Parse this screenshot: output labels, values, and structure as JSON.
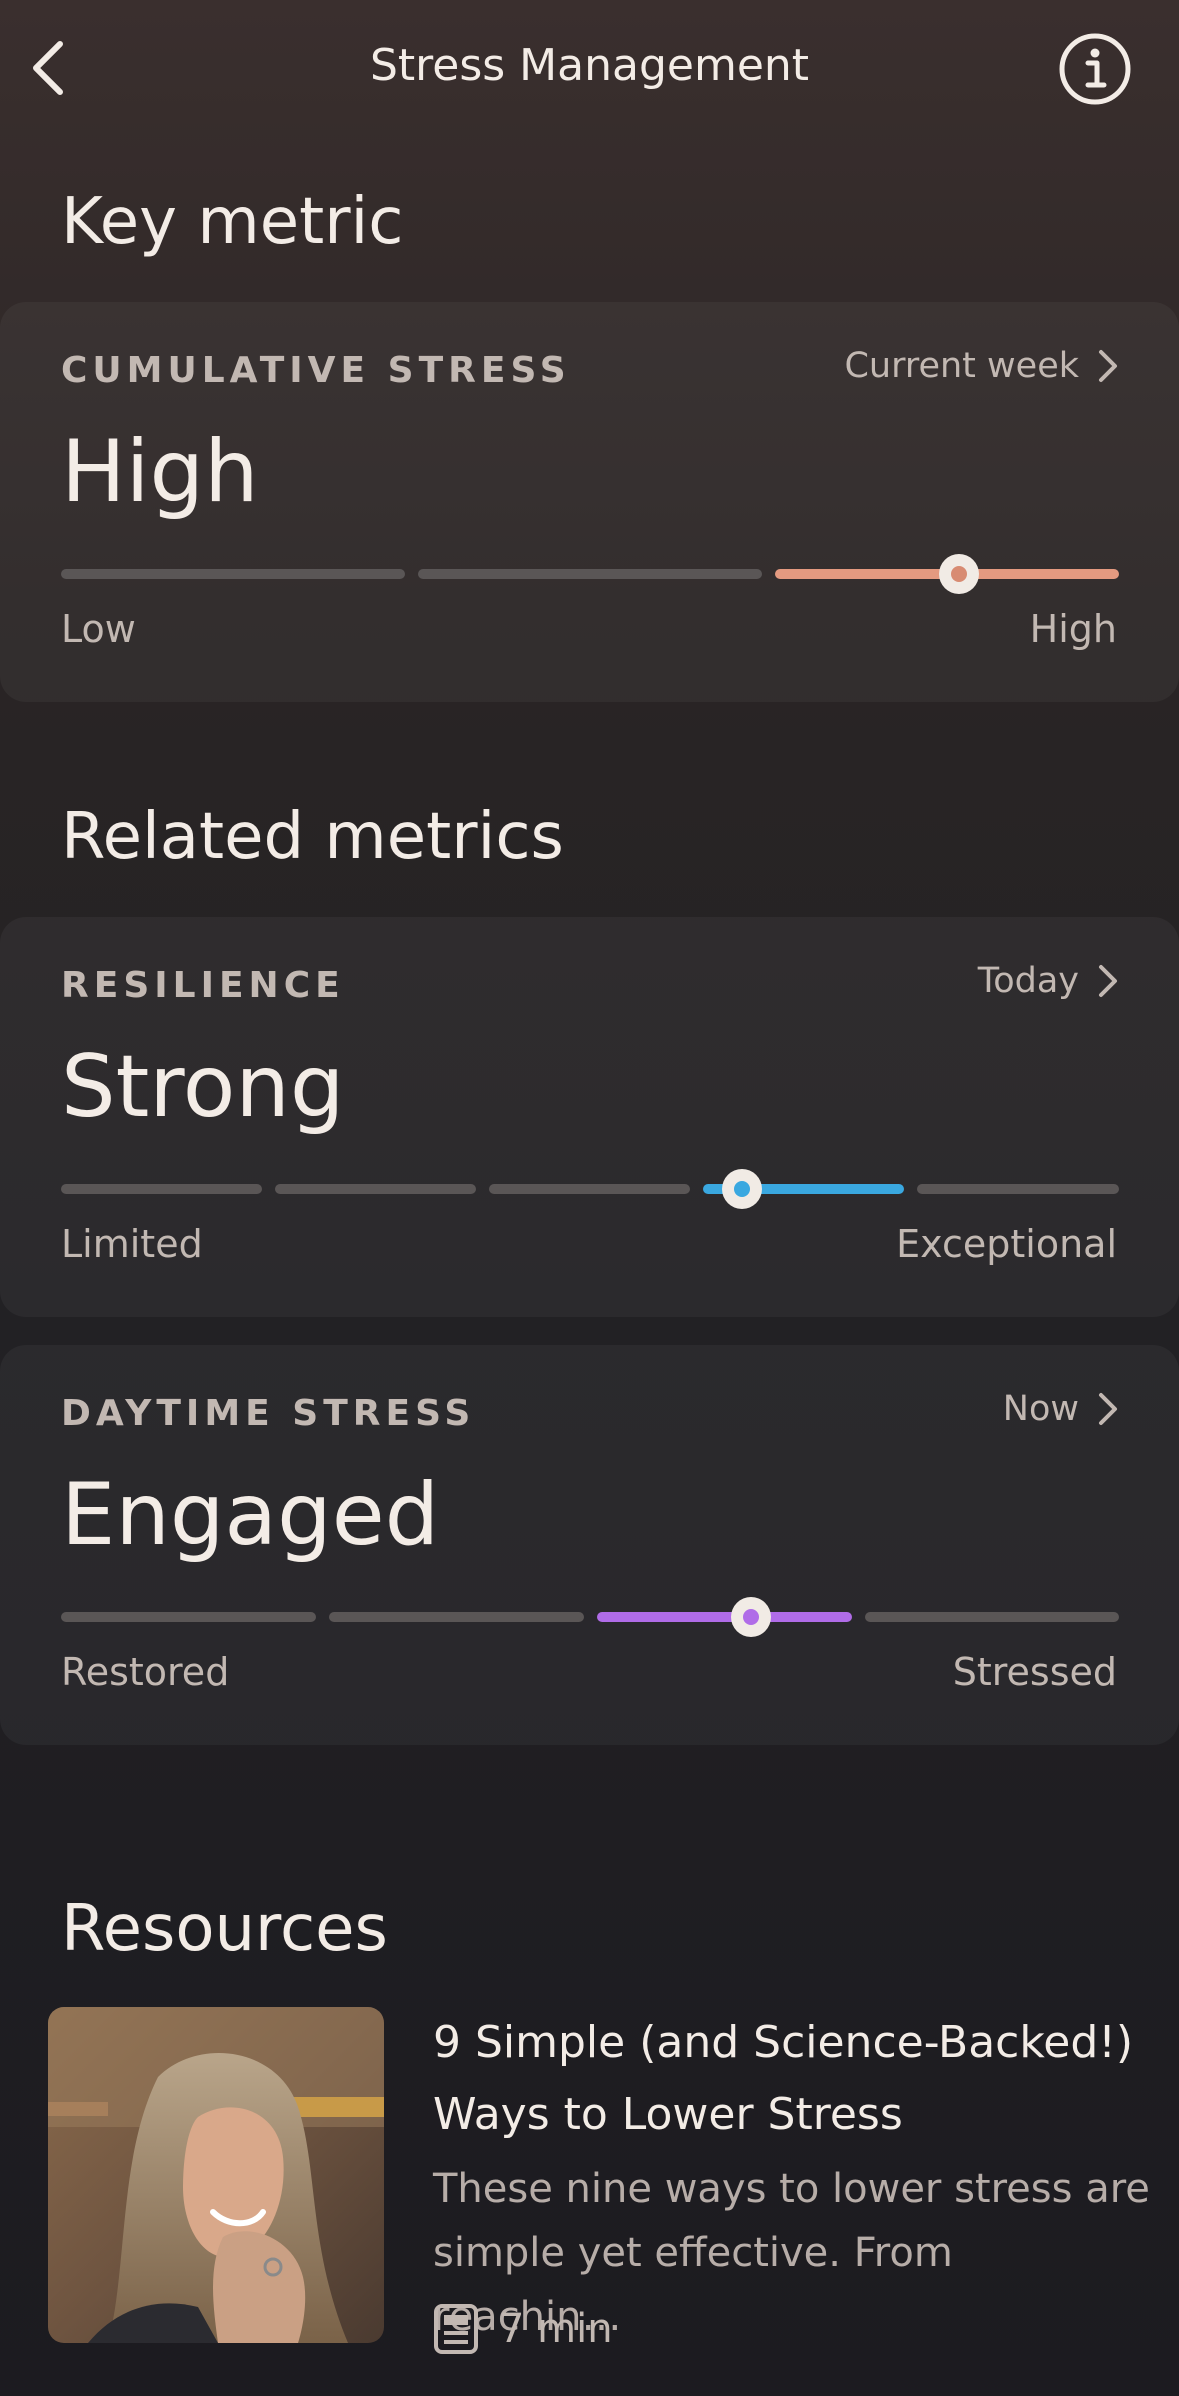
{
  "header": {
    "title": "Stress Management",
    "back_icon": "chevron-left-icon",
    "info_icon": "info-circle-icon"
  },
  "key_metric": {
    "section_title": "Key metric",
    "card": {
      "label": "CUMULATIVE STRESS",
      "period": "Current week",
      "value": "High",
      "scale_min_label": "Low",
      "scale_max_label": "High",
      "segments": 3,
      "active_segment": 3,
      "indicator_position": 0.53,
      "accent_color": "#e49a80"
    }
  },
  "related_metrics": {
    "section_title": "Related metrics",
    "cards": [
      {
        "label": "RESILIENCE",
        "period": "Today",
        "value": "Strong",
        "scale_min_label": "Limited",
        "scale_max_label": "Exceptional",
        "segments": 5,
        "active_segment": 4,
        "indicator_position": 0.2,
        "accent_color": "#3aa8e0"
      },
      {
        "label": "DAYTIME STRESS",
        "period": "Now",
        "value": "Engaged",
        "scale_min_label": "Restored",
        "scale_max_label": "Stressed",
        "segments": 4,
        "active_segment": 3,
        "indicator_position": 0.6,
        "accent_color": "#b06ce8"
      }
    ]
  },
  "resources": {
    "section_title": "Resources",
    "items": [
      {
        "title": "9 Simple (and Science-Backed!) Ways to Lower Stress",
        "description": "These nine ways to lower stress are simple yet effective. From reachin…",
        "read_time": "7 min",
        "read_icon": "article-icon",
        "thumbnail": "smiling-woman-photo"
      }
    ]
  }
}
